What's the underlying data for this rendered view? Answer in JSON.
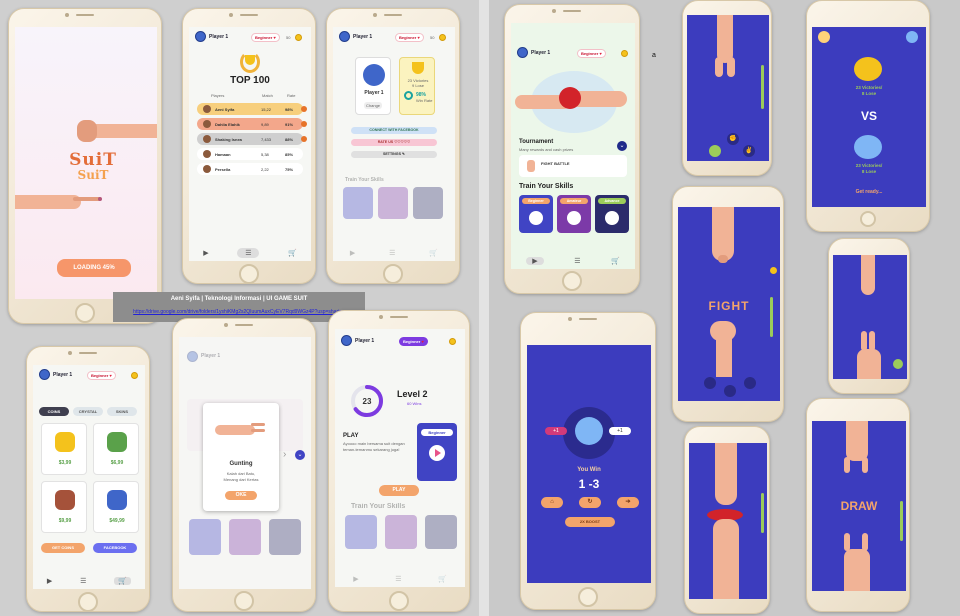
{
  "splash": {
    "logo_top": "SuiT",
    "logo_bottom": "SuiT",
    "loading_label": "LOADING 45%"
  },
  "profile": {
    "player_name": "Player 1",
    "rank_badge": "Beginner",
    "coins": "50"
  },
  "leaderboard": {
    "title": "TOP 100",
    "columns": [
      "Players",
      "Match",
      "Rate"
    ],
    "rows": [
      {
        "rank": "1",
        "name": "Aeni Syifa",
        "match": "15,22",
        "rate": "98%",
        "color": "#f7cf7d"
      },
      {
        "rank": "2",
        "name": "Dahlia Elahik",
        "match": "9,89",
        "rate": "91%",
        "color": "#f3a78b"
      },
      {
        "rank": "3",
        "name": "Shaking Isnea",
        "match": "7,433",
        "rate": "88%",
        "color": "#cfcfcf"
      },
      {
        "rank": "4",
        "name": "Hamaan",
        "match": "5,38",
        "rate": "85%",
        "color": "#ffffff"
      },
      {
        "rank": "5",
        "name": "Persella",
        "match": "2,22",
        "rate": "75%",
        "color": "#ffffff"
      }
    ]
  },
  "settings": {
    "player_label": "Player 1",
    "change_label": "Change",
    "victories_line1": "23 Victories",
    "victories_line2": "9 Lose",
    "percent": "98%",
    "win_rate": "Win Rate",
    "connect_fb": "CONNECT WITH FACEBOOK",
    "rate_us": "RATE US ♡♡♡♡♡",
    "settings_label": "SETTINGS ✎",
    "train_title": "Train Your Skills"
  },
  "caption": {
    "title": "Aeni Syifa | Teknologi Informasi | UI GAME SUIT",
    "url": "https://drive.google.com/drive/folders/1yshiKMg2s2QIuumAuxCyEV7Rqd9WGz4P?usp=sharing"
  },
  "shop": {
    "tabs": [
      "COINS",
      "CRYSTAL",
      "SKINS"
    ],
    "items": [
      {
        "price": "$3,99",
        "icon": "coin-stack-icon"
      },
      {
        "price": "$6,99",
        "icon": "money-bag-icon"
      },
      {
        "price": "$9,99",
        "icon": "treasure-chest-icon"
      },
      {
        "price": "$49,99",
        "icon": "safe-icon"
      }
    ],
    "get_coins": "GET COINS",
    "facebook": "FACEBOOK"
  },
  "popup": {
    "title": "Gunting",
    "desc_line1": "Kalah dari Batu,",
    "desc_line2": "Menang dari Kertas",
    "ok_label": "OKE"
  },
  "level": {
    "number": "23",
    "title": "Level 2",
    "sub": "60 Wins",
    "play_title": "PLAY",
    "play_desc": "Ayoooo main bersama suit dengan teman-temanmu sekarang juga!",
    "card_label": "Beginner",
    "play_button": "PLAY",
    "progress": 0.65
  },
  "home": {
    "tournament": "Tournament",
    "tournament_sub": "Many rewards and cash prizes",
    "fight_battle": "FIGHT BATTLE",
    "train_title": "Train Your Skills",
    "skill_cards": [
      "Beginner",
      "Amateur",
      "Advance"
    ]
  },
  "game": {
    "fight_label": "FIGHT",
    "draw_label": "DRAW",
    "vs_label": "VS",
    "victories": "23 Victories/",
    "lose": "8 Lose",
    "get_ready": "Get ready...",
    "you_win": "You Win",
    "score": "1 -3",
    "boost_label": "2X BOOST",
    "plus_one": "+1"
  },
  "annotation": "a"
}
